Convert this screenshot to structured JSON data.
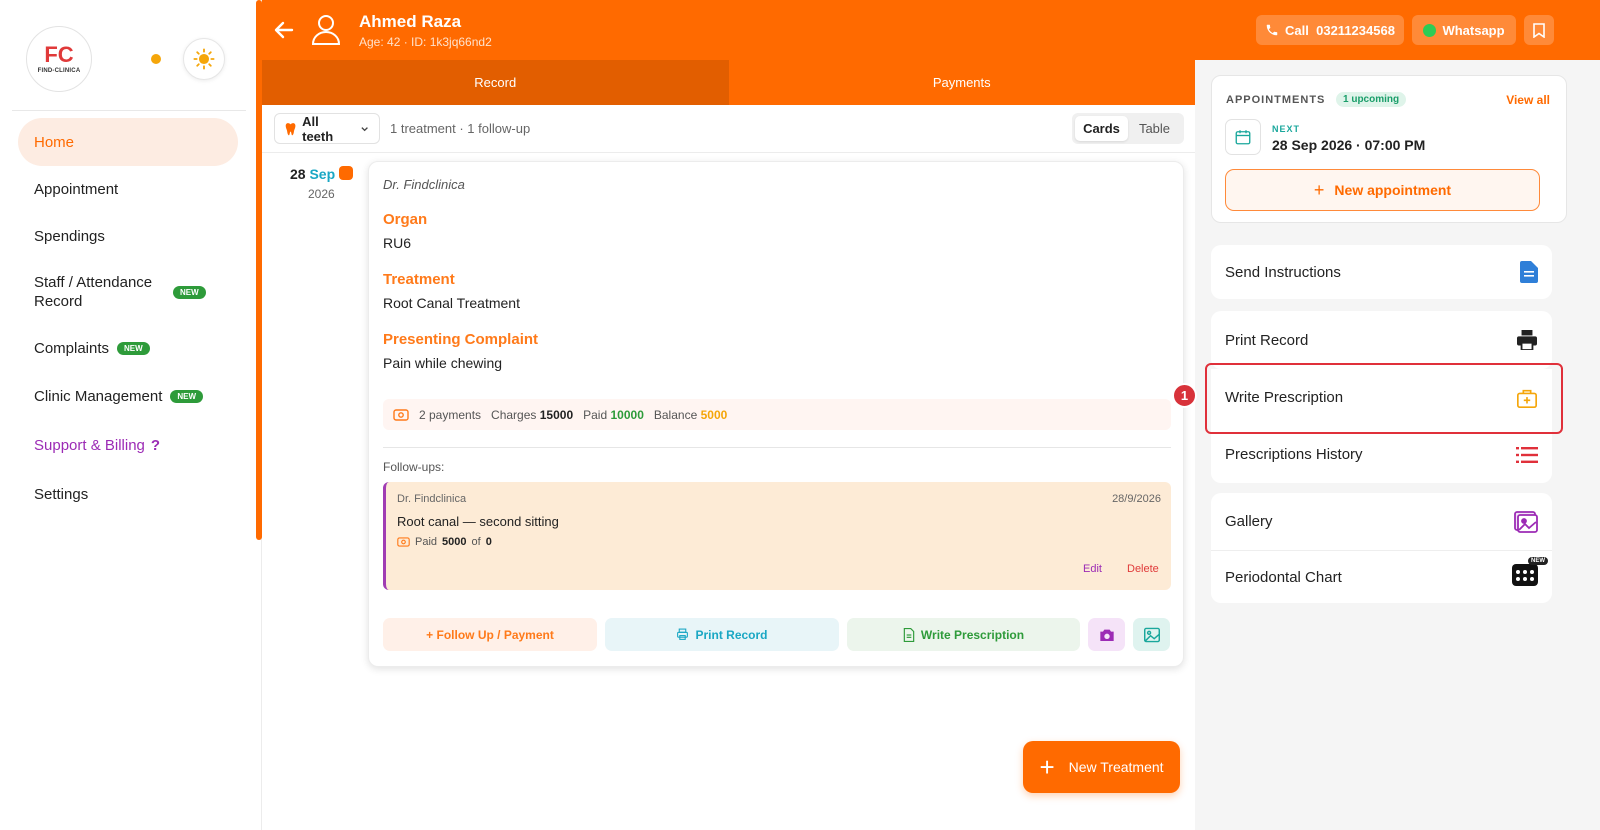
{
  "sidebar": {
    "logo_mark_a": "F",
    "logo_mark_b": "C",
    "logo_text": "FIND-CLINICA",
    "items": [
      {
        "label": "Home"
      },
      {
        "label": "Appointment"
      },
      {
        "label": "Spendings"
      },
      {
        "label": "Staff / Attendance Record",
        "badge": "NEW"
      },
      {
        "label": "Complaints",
        "badge": "NEW"
      },
      {
        "label": "Clinic Management",
        "badge": "NEW"
      },
      {
        "label": "Support & Billing",
        "suffix": "?"
      },
      {
        "label": "Settings"
      }
    ]
  },
  "header": {
    "patient_name": "Ahmed Raza",
    "patient_meta": "Age: 42 · ID: 1k3jq66nd2",
    "call_label": "Call  03211234568",
    "whatsapp_label": "Whatsapp"
  },
  "tabs": [
    {
      "label": "Record",
      "active": true
    },
    {
      "label": "Payments",
      "active": false
    }
  ],
  "filter": {
    "teeth_label": "All teeth",
    "summary": "1 treatment · 1 follow-up",
    "views": [
      "Cards",
      "Table"
    ],
    "active_view": "Cards"
  },
  "record": {
    "date_day": "28",
    "date_month": "Sep",
    "date_year": "2026",
    "doctor": "Dr. Findclinica",
    "sections": [
      {
        "label": "Organ",
        "value": "RU6"
      },
      {
        "label": "Treatment",
        "value": "Root Canal Treatment"
      },
      {
        "label": "Presenting Complaint",
        "value": "Pain while chewing"
      }
    ],
    "payments": {
      "count_text": "2 payments",
      "charges_label": "Charges",
      "charges": "15000",
      "paid_label": "Paid",
      "paid": "10000",
      "balance_label": "Balance",
      "balance": "5000"
    },
    "followups_title": "Follow-ups:",
    "followup": {
      "doctor": "Dr. Findclinica",
      "date": "28/9/2026",
      "text": "Root canal — second sitting",
      "paid_prefix": "Paid",
      "paid_amount": "5000",
      "of_text": "of",
      "of_amount": "0",
      "edit_label": "Edit",
      "delete_label": "Delete"
    },
    "actions": {
      "follow_up": "+ Follow Up / Payment",
      "print": "Print Record",
      "write": "Write Prescription"
    }
  },
  "new_treatment_label": "New Treatment",
  "appointments": {
    "title": "APPOINTMENTS",
    "badge": "1 upcoming",
    "view_all": "View all",
    "next_label": "NEXT",
    "next_date": "28 Sep 2026 · 07:00 PM",
    "new_label": "New appointment"
  },
  "panel": {
    "send_instructions": "Send Instructions",
    "print_record": "Print Record",
    "write_prescription": "Write Prescription",
    "prescriptions_history": "Prescriptions History",
    "gallery": "Gallery",
    "periodontal_chart": "Periodontal Chart",
    "perio_badge": "NEW"
  },
  "annotation": {
    "marker": "1"
  },
  "colors": {
    "brand": "#ff6a00",
    "highlight": "#e0303a",
    "success": "#2e9b3a",
    "purple": "#9c2bb5"
  }
}
